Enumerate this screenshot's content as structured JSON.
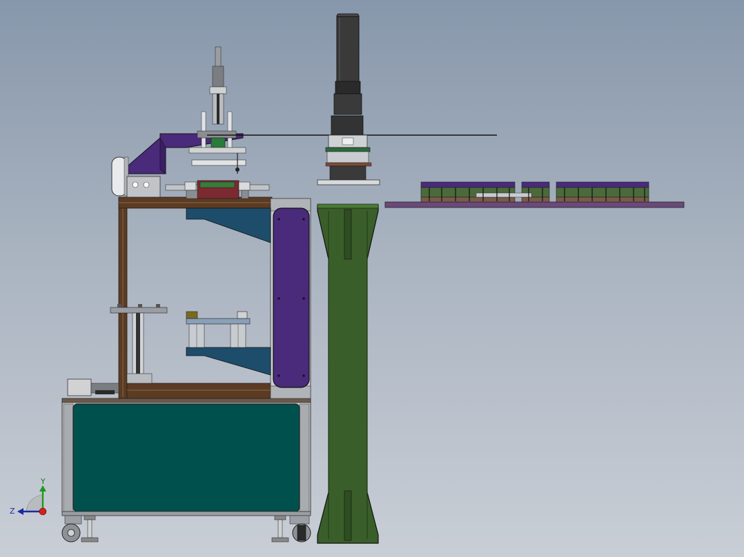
{
  "triad": {
    "y_label": "Y",
    "z_label": "Z"
  },
  "colors": {
    "background_top": "#8797ab",
    "background_bottom": "#c9ced6",
    "cabinet_panel": "#00504e",
    "frame_rail": "#5b3b22",
    "guard_purple": "#4a2a7a",
    "conveyor_purple": "#6a4a7a",
    "pillar_green": "#3a5e2a",
    "actuator_dark": "#3a3a3a",
    "blue_bracket": "#1e4d6b",
    "aluminum": "#b8bcc0"
  }
}
